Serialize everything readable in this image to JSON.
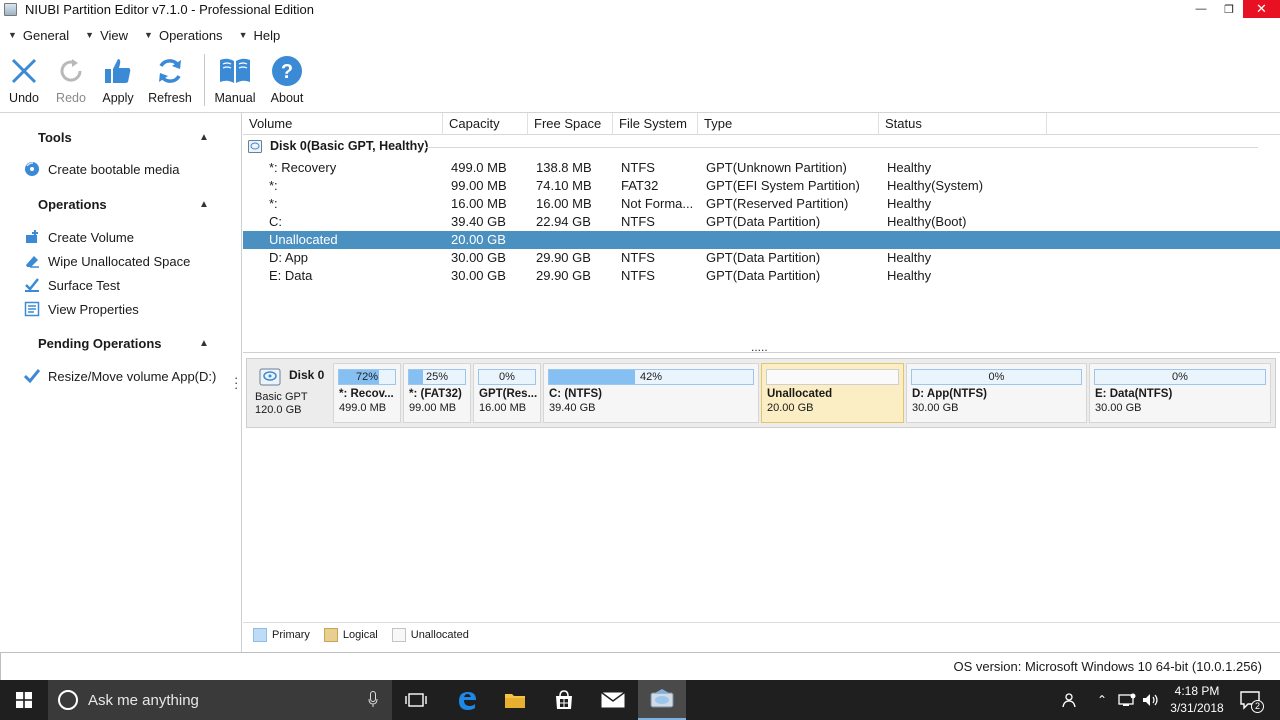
{
  "window": {
    "title": "NIUBI Partition Editor v7.1.0 - Professional Edition",
    "minimize": "—",
    "restore": "❐",
    "close": "✕"
  },
  "menu": [
    "General",
    "View",
    "Operations",
    "Help"
  ],
  "toolbar": {
    "undo": "Undo",
    "redo": "Redo",
    "apply": "Apply",
    "refresh": "Refresh",
    "manual": "Manual",
    "about": "About"
  },
  "left_panel": {
    "tools_title": "Tools",
    "tools_items": [
      "Create bootable media"
    ],
    "operations_title": "Operations",
    "operations_items": [
      "Create Volume",
      "Wipe Unallocated Space",
      "Surface Test",
      "View Properties"
    ],
    "pending_title": "Pending Operations",
    "pending_items": [
      "Resize/Move volume App(D:)"
    ]
  },
  "table": {
    "headers": [
      "Volume",
      "Capacity",
      "Free Space",
      "File System",
      "Type",
      "Status"
    ],
    "disk_label": "Disk 0(Basic GPT, Healthy)",
    "rows": [
      {
        "volume": "*: Recovery",
        "capacity": "499.0 MB",
        "free": "138.8 MB",
        "fs": "NTFS",
        "type": "GPT(Unknown Partition)",
        "status": "Healthy"
      },
      {
        "volume": "*:",
        "capacity": "99.00 MB",
        "free": "74.10 MB",
        "fs": "FAT32",
        "type": "GPT(EFI System Partition)",
        "status": "Healthy(System)"
      },
      {
        "volume": "*:",
        "capacity": "16.00 MB",
        "free": "16.00 MB",
        "fs": "Not Forma...",
        "type": "GPT(Reserved Partition)",
        "status": "Healthy"
      },
      {
        "volume": "C:",
        "capacity": "39.40 GB",
        "free": "22.94 GB",
        "fs": "NTFS",
        "type": "GPT(Data Partition)",
        "status": "Healthy(Boot)"
      },
      {
        "volume": "Unallocated",
        "capacity": "20.00 GB",
        "free": "",
        "fs": "",
        "type": "",
        "status": ""
      },
      {
        "volume": "D: App",
        "capacity": "30.00 GB",
        "free": "29.90 GB",
        "fs": "NTFS",
        "type": "GPT(Data Partition)",
        "status": "Healthy"
      },
      {
        "volume": "E: Data",
        "capacity": "30.00 GB",
        "free": "29.90 GB",
        "fs": "NTFS",
        "type": "GPT(Data Partition)",
        "status": "Healthy"
      }
    ],
    "selected_row": 4,
    "splitter": "....."
  },
  "disk_map": {
    "disk_name": "Disk 0",
    "disk_type": "Basic GPT",
    "disk_size": "120.0 GB",
    "partitions": [
      {
        "pct": "72%",
        "used": 0.72,
        "name": "*: Recov...",
        "size": "499.0 MB",
        "unallocated": false
      },
      {
        "pct": "25%",
        "used": 0.25,
        "name": "*: (FAT32)",
        "size": "99.00 MB",
        "unallocated": false
      },
      {
        "pct": "0%",
        "used": 0.0,
        "name": "GPT(Res...",
        "size": "16.00 MB",
        "unallocated": false
      },
      {
        "pct": "42%",
        "used": 0.42,
        "name": "C: (NTFS)",
        "size": "39.40 GB",
        "unallocated": false
      },
      {
        "pct": "",
        "used": 0.0,
        "name": "Unallocated",
        "size": "20.00 GB",
        "unallocated": true
      },
      {
        "pct": "0%",
        "used": 0.0,
        "name": "D: App(NTFS)",
        "size": "30.00 GB",
        "unallocated": false
      },
      {
        "pct": "0%",
        "used": 0.0,
        "name": "E: Data(NTFS)",
        "size": "30.00 GB",
        "unallocated": false
      }
    ]
  },
  "legend": [
    "Primary",
    "Logical",
    "Unallocated"
  ],
  "status": {
    "os_version": "OS version: Microsoft Windows 10  64-bit  (10.0.1.256)"
  },
  "taskbar": {
    "search_placeholder": "Ask me anything",
    "time": "4:18 PM",
    "date": "3/31/2018",
    "notification_count": "2"
  },
  "colors": {
    "selection": "#4a90c0",
    "primary_fill": "#86c0f2",
    "unallocated_fill": "#fbeec4",
    "taskbar": "#1f1f1f"
  }
}
